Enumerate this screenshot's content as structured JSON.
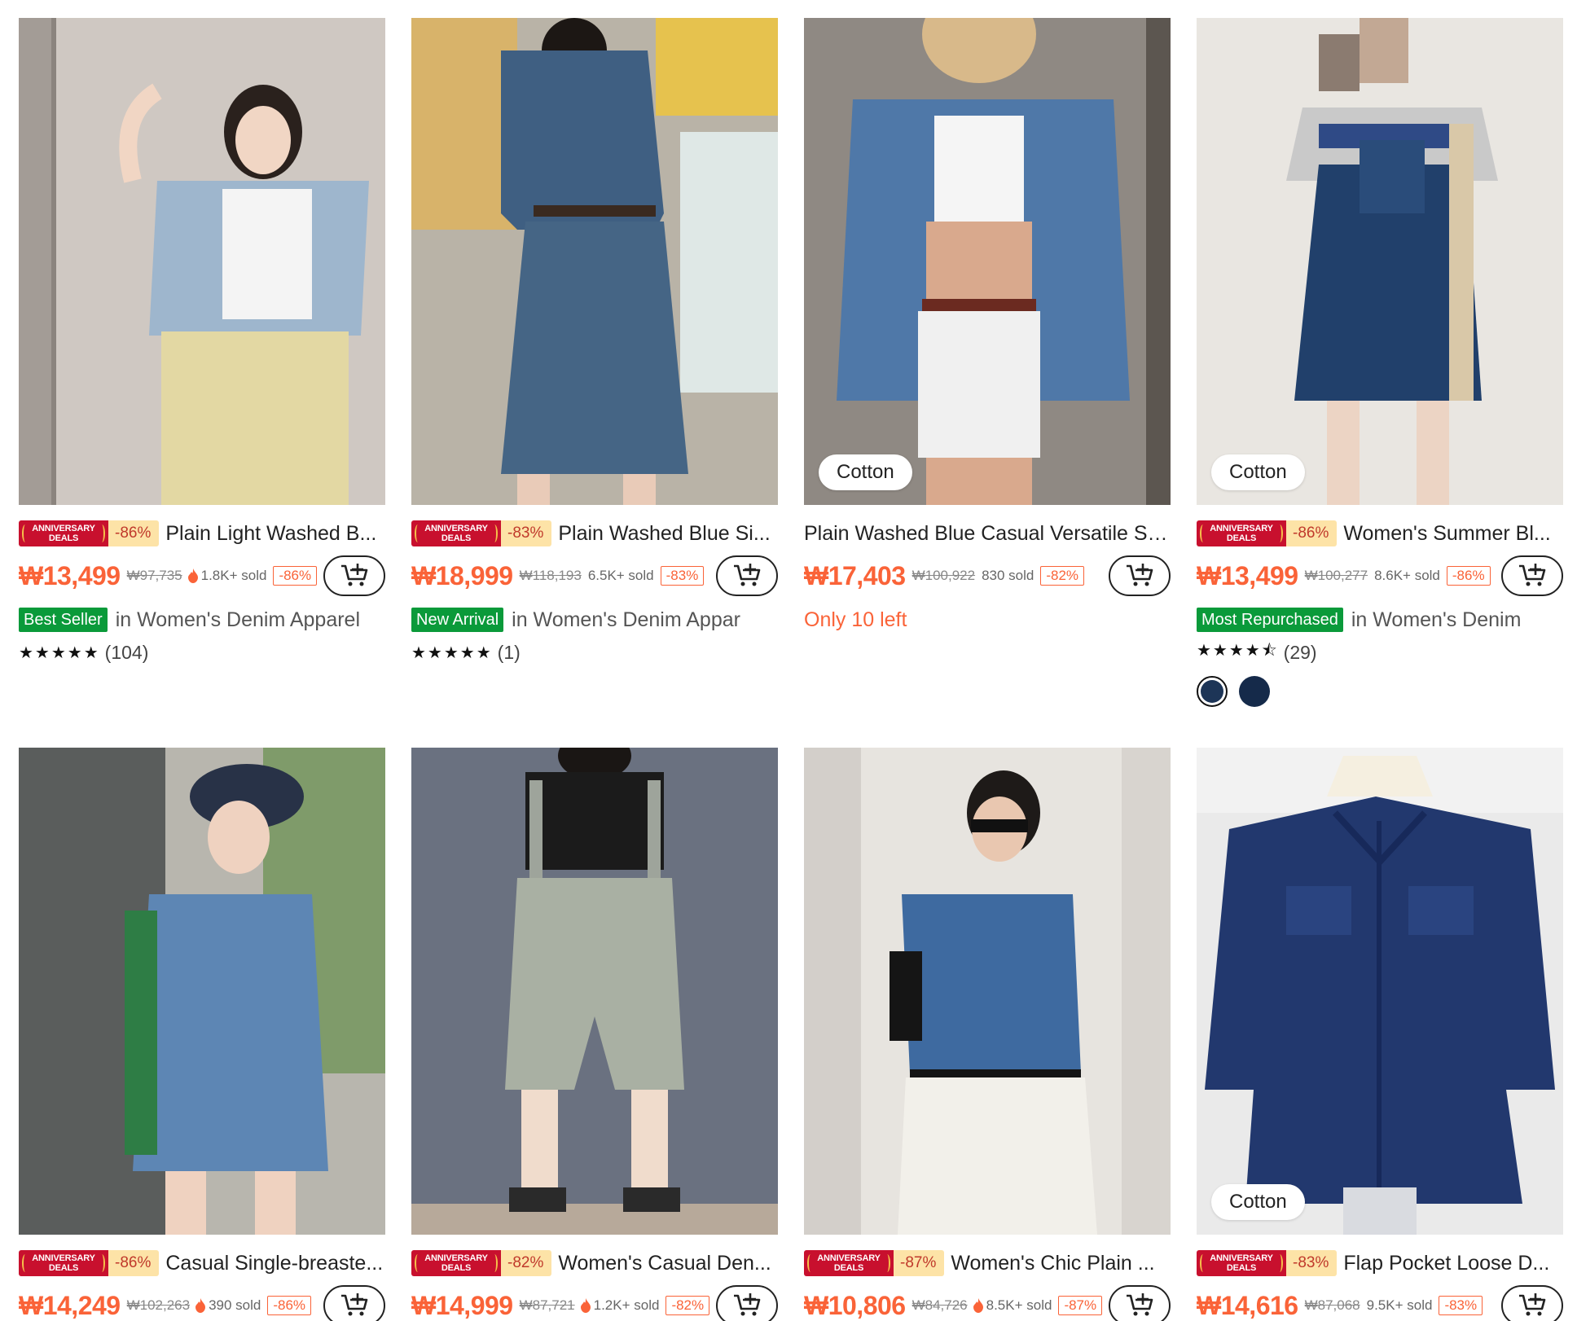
{
  "colors": {
    "accent": "#fa6338",
    "deal_red": "#c8102e",
    "rank_green": "#0a9a3a"
  },
  "deal_badge": {
    "line1": "ANNIVERSARY",
    "line2": "DEALS"
  },
  "products": [
    {
      "material": "",
      "deal_pct": "-86%",
      "title": "Plain Light Washed B...",
      "price": "₩13,499",
      "orig": "₩97,735",
      "sold": "1.8K+ sold",
      "pct": "-86%",
      "rank": "Best Seller",
      "rank_cat": "in Women's Denim Apparel",
      "stock": "",
      "stars": "★★★★★",
      "rating": "(104)"
    },
    {
      "material": "",
      "deal_pct": "-83%",
      "title": "Plain Washed Blue Si...",
      "price": "₩18,999",
      "orig": "₩118,193",
      "sold": "6.5K+ sold",
      "pct": "-83%",
      "rank": "New Arrival",
      "rank_cat": "in Women's Denim Appar",
      "stock": "",
      "stars": "★★★★★",
      "rating": "(1)"
    },
    {
      "material": "Cotton",
      "deal_pct": "",
      "title": "Plain Washed Blue Casual Versatile Sli...",
      "price": "₩17,403",
      "orig": "₩100,922",
      "sold": "830 sold",
      "pct": "-82%",
      "rank": "",
      "rank_cat": "",
      "stock": "Only 10 left",
      "stars": "",
      "rating": ""
    },
    {
      "material": "Cotton",
      "deal_pct": "-86%",
      "title": "Women's Summer Bl...",
      "price": "₩13,499",
      "orig": "₩100,277",
      "sold": "8.6K+ sold",
      "pct": "-86%",
      "rank": "Most Repurchased",
      "rank_cat": "in Women's Denim",
      "stock": "",
      "stars": "★★★★⯪",
      "rating": "(29)",
      "swatches": [
        "#1d3557",
        "#152a4a"
      ]
    },
    {
      "material": "",
      "deal_pct": "-86%",
      "title": "Casual Single-breaste...",
      "price": "₩14,249",
      "orig": "₩102,263",
      "sold": "390 sold",
      "pct": "-86%"
    },
    {
      "material": "",
      "deal_pct": "-82%",
      "title": "Women's Casual Den...",
      "price": "₩14,999",
      "orig": "₩87,721",
      "sold": "1.2K+ sold",
      "pct": "-82%"
    },
    {
      "material": "",
      "deal_pct": "-87%",
      "title": "Women's Chic Plain ...",
      "price": "₩10,806",
      "orig": "₩84,726",
      "sold": "8.5K+ sold",
      "pct": "-87%"
    },
    {
      "material": "Cotton",
      "deal_pct": "-83%",
      "title": "Flap Pocket Loose D...",
      "price": "₩14,616",
      "orig": "₩87,068",
      "sold": "9.5K+ sold",
      "pct": "-83%"
    }
  ]
}
